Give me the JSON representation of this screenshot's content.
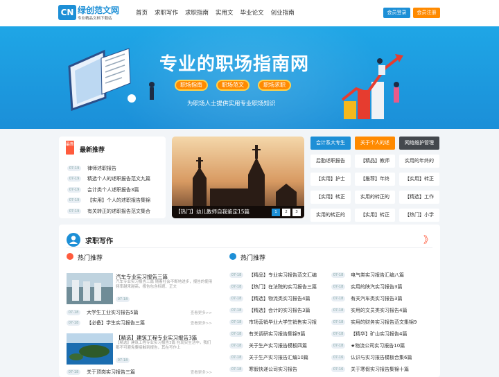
{
  "header": {
    "logo_mark": "CN",
    "logo_text": "绿创范文网",
    "logo_sub": "专业精品文档下载站",
    "nav": [
      "首页",
      "求职写作",
      "求职指南",
      "实用文",
      "毕业论文",
      "创业指南"
    ],
    "login": "会员登录",
    "register": "会员注册"
  },
  "banner": {
    "title": "专业的职场指南网",
    "tags": [
      "职场指南",
      "职场范文",
      "职场求职"
    ],
    "subtitle": "为职场人士提供实用专业职场知识"
  },
  "latest": {
    "badge": "最新",
    "title": "最新推荐",
    "items": [
      {
        "date": "07-19",
        "text": "律师述职报告"
      },
      {
        "date": "07-19",
        "text": "精选个人的述职报告范文九篇"
      },
      {
        "date": "07-19",
        "text": "会计类个人述职报告3篇"
      },
      {
        "date": "07-19",
        "text": "【实用】个人的述职报告集锦"
      },
      {
        "date": "07-19",
        "text": "有关转正的述职报告范文集合"
      }
    ]
  },
  "slider": {
    "caption": "【热门】幼儿教师自我鉴定15篇",
    "pages": [
      "1",
      "2",
      "3"
    ]
  },
  "tag_grid": [
    [
      "会计系大专生",
      "关于个人的述",
      "网络维护管理"
    ],
    [
      "后勤述职报告",
      "【精品】教师",
      "实用的年终的"
    ],
    [
      "【实用】护士",
      "【推荐】年终",
      "【实用】转正"
    ],
    [
      "【实用】转正",
      "实用的转正的",
      "【精选】工作"
    ],
    [
      "实用的转正的",
      "【实用】转正",
      "【热门】小学"
    ]
  ],
  "section": {
    "title": "求职写作",
    "more": "》",
    "left_head": "热门推荐",
    "right_head": "热门推荐",
    "feature1": {
      "title": "汽车专业实习报告三篇",
      "desc": "汽车专业实习报告三篇 随着社会不断地进步，报告的使用频率越来越高，报告包含标题、正文",
      "date": "07-18"
    },
    "plain_rows": [
      {
        "date": "07-18",
        "text": "大学生工业实习报告5篇",
        "see": "查看更多>>"
      },
      {
        "date": "07-18",
        "text": "【必备】学生实习报告三篇",
        "see": "查看更多>>"
      }
    ],
    "feature2": {
      "title": "【精选】建筑工程专业实习报告3篇",
      "desc": "【精选】建筑工程专业实习报告3篇 在现实生活中，我们都不可避免要接触到报告，其在写作上",
      "date": "07-18"
    },
    "plain_row3": {
      "date": "07-18",
      "text": "关于顶岗实习报告三篇",
      "see": "查看更多>>"
    },
    "mid_list": [
      {
        "date": "07-18",
        "text": "【精品】专业实习报告范文汇编"
      },
      {
        "date": "07-18",
        "text": "【热门】在法院的实习报告三篇"
      },
      {
        "date": "07-18",
        "text": "【精选】物流类实习报告4篇"
      },
      {
        "date": "07-18",
        "text": "【精选】会计的实习报告3篇"
      },
      {
        "date": "07-18",
        "text": "市场营销毕业大学生销售实习报"
      },
      {
        "date": "07-18",
        "text": "有关调研实习报告集锦9篇"
      },
      {
        "date": "07-18",
        "text": "关于生产实习报告模板四篇"
      },
      {
        "date": "07-18",
        "text": "关于生产实习报告汇编10篇"
      },
      {
        "date": "07-18",
        "text": "寒假快递公司实习报告"
      }
    ],
    "right_list": [
      {
        "date": "07-18",
        "text": "电气类实习报告汇编八篇"
      },
      {
        "date": "07-18",
        "text": "实用的陕汽实习报告3篇"
      },
      {
        "date": "07-18",
        "text": "有关汽车类实习报告3篇"
      },
      {
        "date": "07-18",
        "text": "实用的文员类实习报告4篇"
      },
      {
        "date": "07-18",
        "text": "实用的财务实习报告范文集锦9"
      },
      {
        "date": "07-18",
        "text": "【精华】矿山实习报告4篇"
      },
      {
        "date": "07-18",
        "text": "★物流公司实习报告10篇"
      },
      {
        "date": "07-16",
        "text": "认识与实习报告模板合集6篇"
      },
      {
        "date": "07-16",
        "text": "关于寒假实习报告集锦十篇"
      }
    ]
  },
  "colors": {
    "brand": "#1d8fd6",
    "accent": "#ff8a00",
    "banner": "#1b8fd8"
  }
}
